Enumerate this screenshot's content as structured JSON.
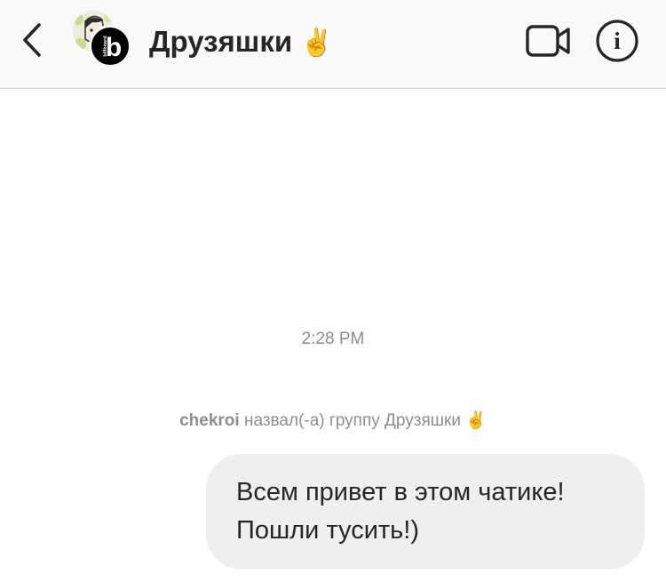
{
  "header": {
    "title": "Друзяшки",
    "title_emoji": "✌️",
    "back_icon": "chevron-left-icon",
    "video_icon": "video-camera-icon",
    "info_icon": "info-icon",
    "info_glyph": "i",
    "avatar_front_letter": "b",
    "avatar_front_word": "billboard"
  },
  "chat": {
    "timestamp": "2:28 PM",
    "system_message": {
      "user": "chekroi",
      "text": "назвал(-а) группу Друзяшки",
      "emoji": "✌️"
    },
    "messages": [
      {
        "lines": [
          "Всем привет в этом чатике!",
          "Пошли тусить!)"
        ]
      }
    ]
  },
  "colors": {
    "header_bg": "#f9f9f9",
    "text_primary": "#262626",
    "text_secondary": "#8e8e8e",
    "bubble_bg": "#efefef"
  }
}
